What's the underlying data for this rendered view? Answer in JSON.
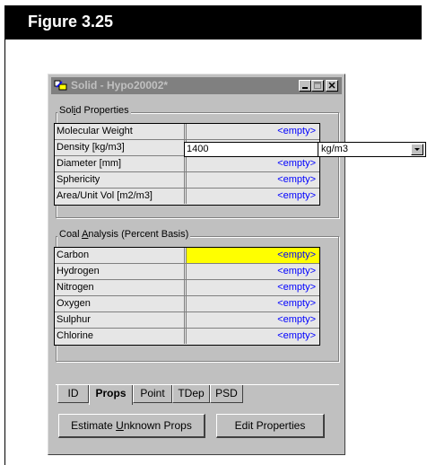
{
  "figure": {
    "label": "Figure 3.25"
  },
  "window": {
    "title": "Solid - Hypo20002*",
    "icon": "app-icon",
    "controls": [
      "minimize-icon",
      "maximize-icon",
      "close-icon"
    ]
  },
  "solid_properties": {
    "label_pre": "Sol",
    "label_key": "i",
    "label_post": "d Properties",
    "rows": [
      {
        "name": "Molecular Weight",
        "value": "<empty>"
      },
      {
        "name": "Density [kg/m3]",
        "value": "1400"
      },
      {
        "name": "Diameter [mm]",
        "value": "<empty>"
      },
      {
        "name": "Sphericity",
        "value": "<empty>"
      },
      {
        "name": "Area/Unit Vol [m2/m3]",
        "value": "<empty>"
      }
    ],
    "edit_value": "1400",
    "unit": "kg/m3"
  },
  "coal_analysis": {
    "label_pre": "Coal ",
    "label_key": "A",
    "label_post": "nalysis (Percent Basis)",
    "rows": [
      {
        "name": "Carbon",
        "value": "<empty>"
      },
      {
        "name": "Hydrogen",
        "value": "<empty>"
      },
      {
        "name": "Nitrogen",
        "value": "<empty>"
      },
      {
        "name": "Oxygen",
        "value": "<empty>"
      },
      {
        "name": "Sulphur",
        "value": "<empty>"
      },
      {
        "name": "Chlorine",
        "value": "<empty>"
      }
    ],
    "highlight_color": "#ffff00"
  },
  "tabs": [
    {
      "label": "ID",
      "active": false
    },
    {
      "label": "Props",
      "active": true
    },
    {
      "label": "Point",
      "active": false
    },
    {
      "label": "TDep",
      "active": false
    },
    {
      "label": "PSD",
      "active": false
    }
  ],
  "buttons": {
    "estimate_pre": "Estimate ",
    "estimate_key": "U",
    "estimate_post": "nknown Props",
    "edit": "Edit Properties"
  },
  "colors": {
    "value_text": "#0000ff",
    "window_bg": "#c0c0c0",
    "titlebar_inactive": "#808080"
  }
}
